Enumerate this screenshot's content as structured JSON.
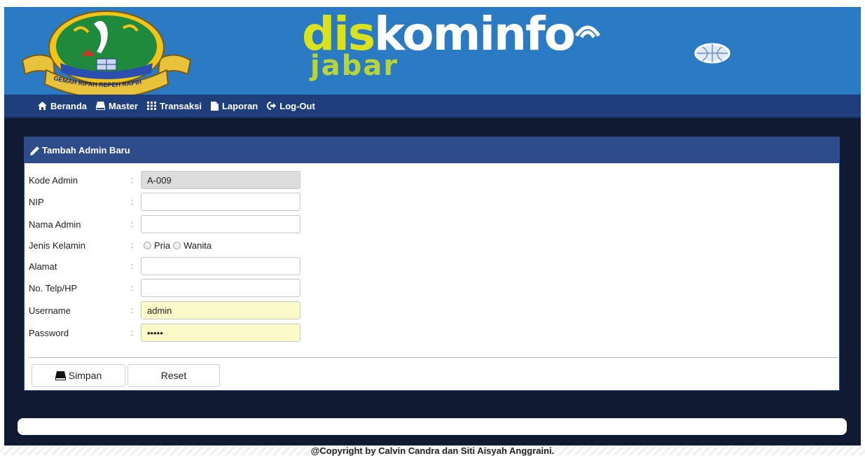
{
  "header": {
    "seal_motto": "GEMAH RIPAH REPEH RAPIH",
    "brand_part1": "dis",
    "brand_part2": "kominfo",
    "brand_sub": "jabar",
    "colors": {
      "header_bg": "#2a7bc4",
      "brand_yellow": "#d9e21a",
      "brand_green": "#b9d435"
    }
  },
  "nav": {
    "items": [
      {
        "label": "Beranda",
        "icon": "home-icon"
      },
      {
        "label": "Master",
        "icon": "drive-icon"
      },
      {
        "label": "Transaksi",
        "icon": "grid-icon"
      },
      {
        "label": "Laporan",
        "icon": "document-icon"
      },
      {
        "label": "Log-Out",
        "icon": "logout-icon"
      }
    ]
  },
  "form": {
    "title": "Tambah Admin Baru",
    "colon": ":",
    "fields": {
      "kode_admin": {
        "label": "Kode Admin",
        "value": "A-009"
      },
      "nip": {
        "label": "NIP",
        "value": ""
      },
      "nama_admin": {
        "label": "Nama Admin",
        "value": ""
      },
      "jenis_kelamin": {
        "label": "Jenis Kelamin",
        "options": [
          "Pria",
          "Wanita"
        ]
      },
      "alamat": {
        "label": "Alamat",
        "value": ""
      },
      "telp": {
        "label": "No. Telp/HP",
        "value": ""
      },
      "username": {
        "label": "Username",
        "value": "admin"
      },
      "password": {
        "label": "Password",
        "value": "•••••"
      }
    },
    "buttons": {
      "save": "Simpan",
      "reset": "Reset"
    }
  },
  "footer": {
    "copyright": "@Copyright by Calvin Candra dan Siti Aisyah Anggraini."
  }
}
